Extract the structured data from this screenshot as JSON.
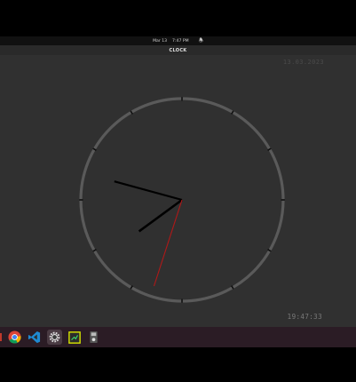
{
  "topbar": {
    "date": "Mar 13",
    "time": "7:47 PM",
    "bell_icon": "bell-icon"
  },
  "window": {
    "title": "CLOCK"
  },
  "clock": {
    "date_text": "13.03.2023",
    "time_text": "19:47:33",
    "hours": 19,
    "minutes": 47,
    "seconds": 33,
    "colors": {
      "face_ring": "#5a5a5a",
      "hands": "#000000",
      "second_hand": "#b01818",
      "background": "#303030"
    }
  },
  "dock": {
    "apps": [
      {
        "name": "chrome-icon",
        "active": false
      },
      {
        "name": "vscode-icon",
        "active": false
      },
      {
        "name": "settings-icon",
        "active": true
      },
      {
        "name": "terminal-app-icon",
        "active": false
      },
      {
        "name": "device-app-icon",
        "active": false
      }
    ]
  }
}
